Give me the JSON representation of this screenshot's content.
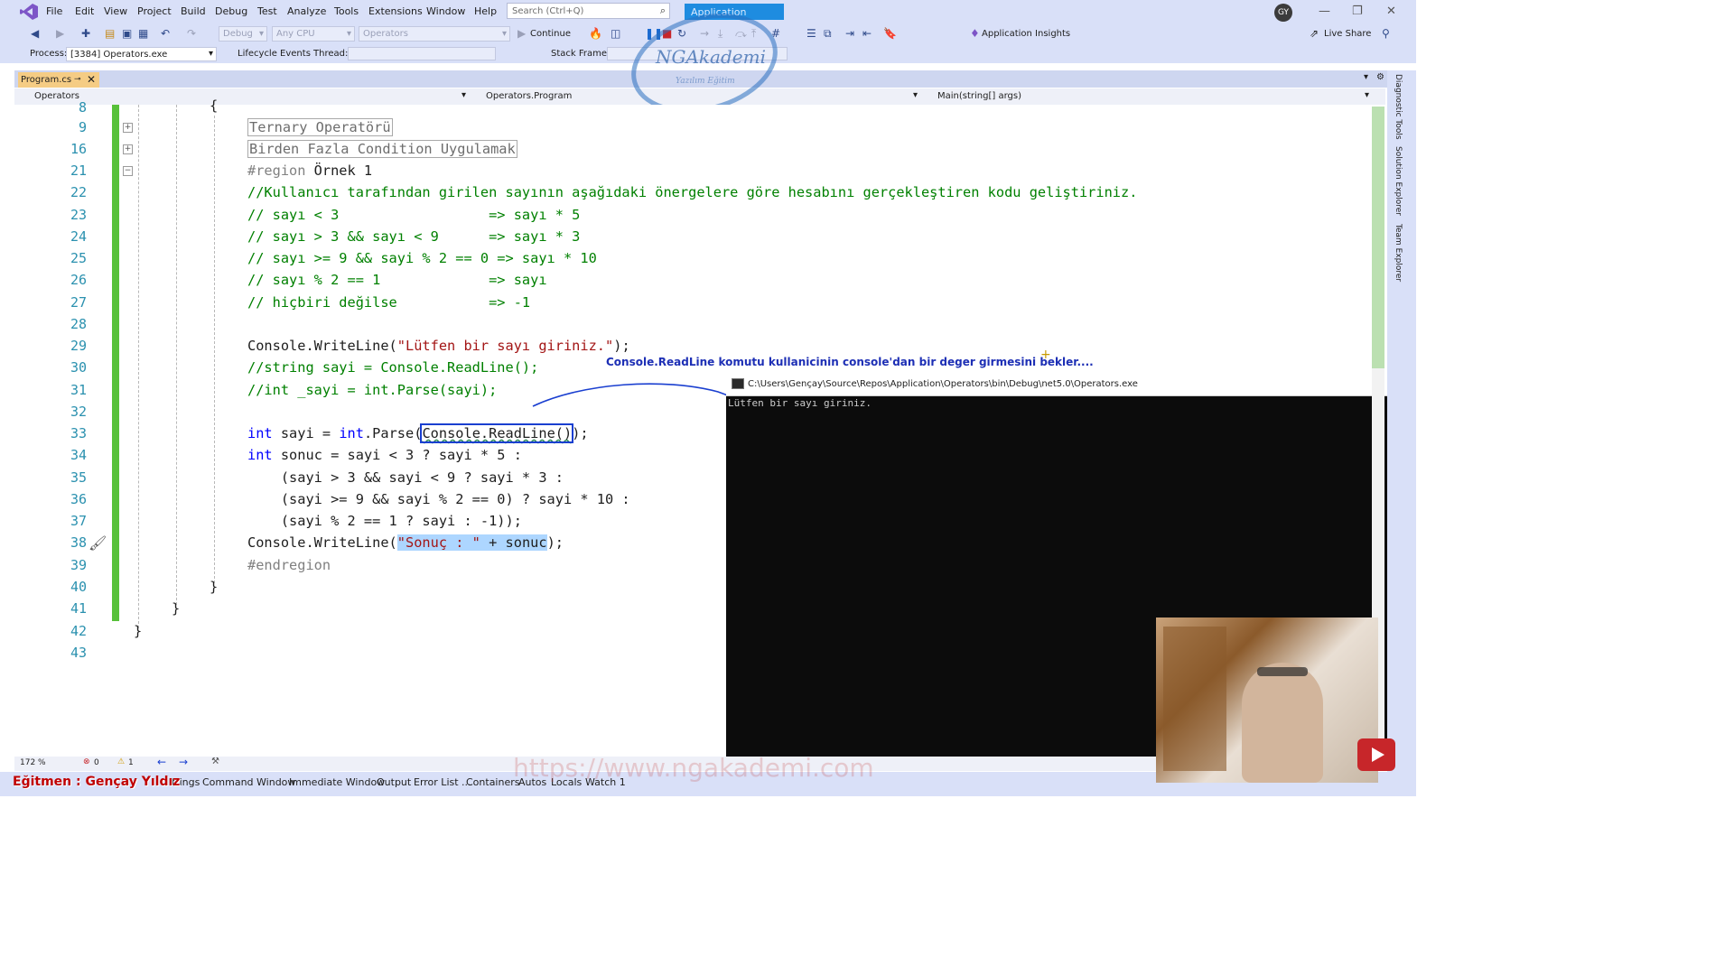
{
  "menubar": {
    "items": [
      "File",
      "Edit",
      "View",
      "Project",
      "Build",
      "Debug",
      "Test",
      "Analyze",
      "Tools",
      "Extensions",
      "Window",
      "Help"
    ],
    "search_placeholder": "Search (Ctrl+Q)",
    "solution_title": "Application",
    "avatar_initials": "GY"
  },
  "toolbar": {
    "config": "Debug",
    "platform": "Any CPU",
    "startup": "Operators",
    "continue_label": "Continue",
    "app_insights": "Application Insights",
    "live_share": "Live Share"
  },
  "processbar": {
    "process_label": "Process:",
    "process_value": "[3384] Operators.exe",
    "lifecycle_label": "Lifecycle Events",
    "thread_label": "Thread:",
    "stackframe_label": "Stack Frame:"
  },
  "tab": {
    "label": "Program.cs"
  },
  "navbar": {
    "project": "Operators",
    "type": "Operators.Program",
    "member": "Main(string[] args)"
  },
  "watermark": {
    "brand": "NGAkademi",
    "tagline": "Yazılım Eğitim"
  },
  "editor": {
    "lines": [
      {
        "num": "8",
        "text": "{"
      },
      {
        "num": "9",
        "text": "Ternary Operatörü"
      },
      {
        "num": "16",
        "text": "Birden Fazla Condition Uygulamak"
      },
      {
        "num": "21",
        "a": "#region",
        "b": " Örnek 1"
      },
      {
        "num": "22",
        "text": "//Kullanıcı tarafından girilen sayının aşağıdaki önergelere göre hesabını gerçekleştiren kodu geliştiriniz."
      },
      {
        "num": "23",
        "text": "// sayı < 3                  => sayı * 5"
      },
      {
        "num": "24",
        "text": "// sayı > 3 && sayı < 9      => sayı * 3"
      },
      {
        "num": "25",
        "text": "// sayı >= 9 && sayi % 2 == 0 => sayı * 10"
      },
      {
        "num": "26",
        "text": "// sayı % 2 == 1             => sayı"
      },
      {
        "num": "27",
        "text": "// hiçbiri değilse           => -1"
      },
      {
        "num": "28",
        "text": ""
      },
      {
        "num": "29",
        "a": "Console.WriteLine(",
        "b": "\"Lütfen bir sayı giriniz.\"",
        "c": ");"
      },
      {
        "num": "30",
        "text": "//string sayi = Console.ReadLine();"
      },
      {
        "num": "31",
        "text": "//int _sayi = int.Parse(sayi);"
      },
      {
        "num": "32",
        "text": ""
      },
      {
        "num": "33",
        "a": "int",
        "b": " sayi = ",
        "c": "int",
        ",d": "",
        "d": ".Parse(",
        "e": "Console.ReadLine()",
        "f": ");"
      },
      {
        "num": "34",
        "a": "int",
        "b": " sonuc = sayi < 3 ? sayi * 5 :"
      },
      {
        "num": "35",
        "text": "    (sayi > 3 && sayi < 9 ? sayi * 3 :"
      },
      {
        "num": "36",
        "text": "    (sayi >= 9 && sayi % 2 == 0) ? sayi * 10 :"
      },
      {
        "num": "37",
        "text": "    (sayi % 2 == 1 ? sayi : -1));"
      },
      {
        "num": "38",
        "a": "Console.WriteLine(",
        "b": "\"Sonuç : \"",
        "c": " + sonuc",
        "d": ");"
      },
      {
        "num": "39",
        "text": "#endregion"
      },
      {
        "num": "40",
        "text": "}"
      },
      {
        "num": "41",
        "text": "}"
      },
      {
        "num": "42",
        "text": "}"
      },
      {
        "num": "43",
        "text": ""
      }
    ]
  },
  "annotation": "Console.ReadLine komutu kullanicinin console'dan bir deger girmesini bekler....",
  "console": {
    "title": "C:\\Users\\Gençay\\Source\\Repos\\Application\\Operators\\bin\\Debug\\net5.0\\Operators.exe",
    "output": "Lütfen bir sayı giriniz."
  },
  "statusbar": {
    "zoom": "172 %",
    "errors": "0",
    "warnings": "1"
  },
  "bottom_tabs": [
    "Command Window",
    "Immediate Window",
    "Output",
    "Error List ...",
    "Containers",
    "Autos",
    "Locals",
    "Watch 1"
  ],
  "bottom_partial": "ttings",
  "instructor": "Eğitmen : Gençay Yıldız",
  "url_watermark": "https://www.ngakademi.com",
  "right_strip": [
    "Diagnostic Tools",
    "Solution Explorer",
    "Team Explorer"
  ]
}
